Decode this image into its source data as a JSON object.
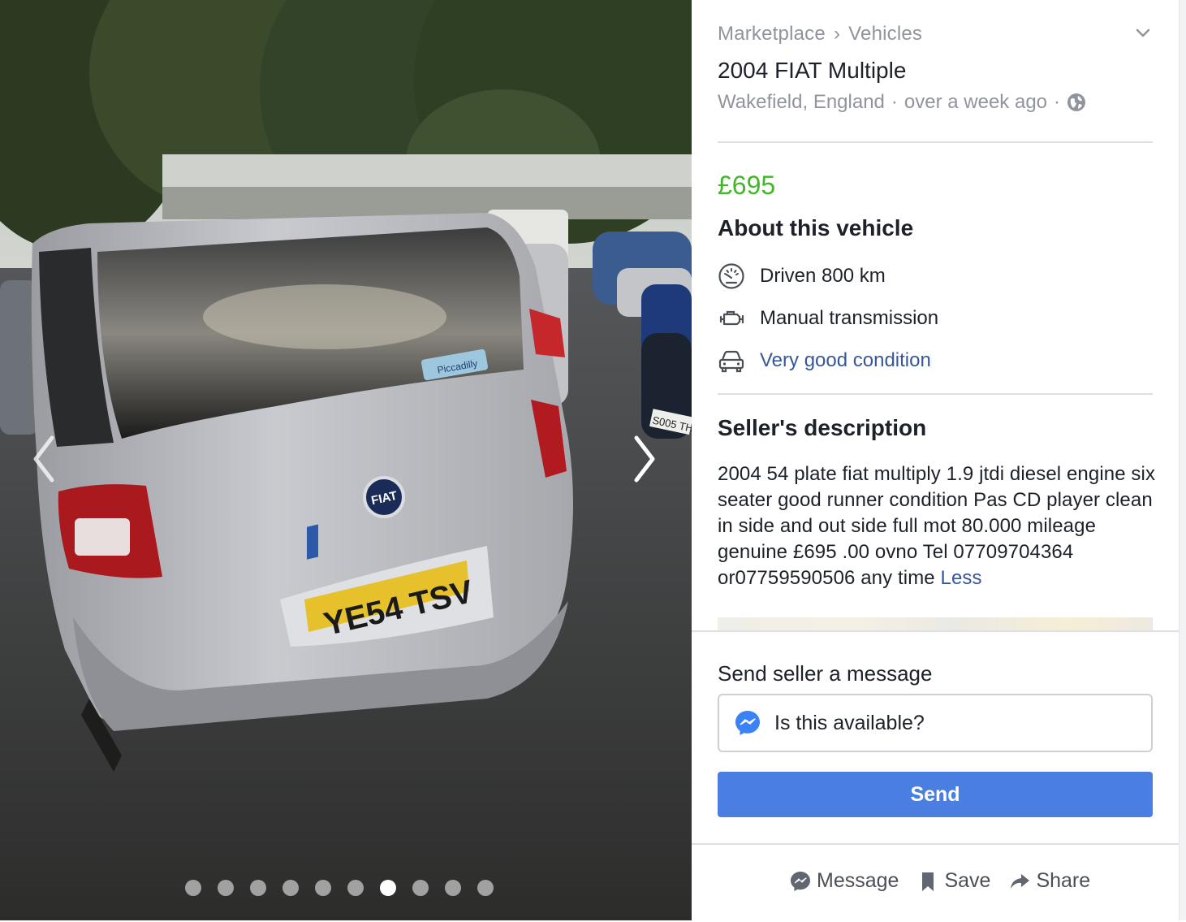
{
  "photo": {
    "plate_text": "YE54 TSV",
    "badge_text": "FIAT",
    "sticker_text": "Piccadilly",
    "bg_plate_text": "S005 TH",
    "slide_count": 10,
    "active_slide": 7
  },
  "panel": {
    "breadcrumb": {
      "root": "Marketplace",
      "separator": "›",
      "category": "Vehicles"
    },
    "title": "2004 FIAT Multiple",
    "location": "Wakefield, England",
    "time": "over a week ago",
    "price": "£695",
    "about_heading": "About this vehicle",
    "attributes": [
      {
        "icon": "speedometer-icon",
        "label": "Driven 800 km"
      },
      {
        "icon": "engine-icon",
        "label": "Manual transmission"
      },
      {
        "icon": "car-icon",
        "label": "Very good condition"
      }
    ],
    "seller_heading": "Seller's description",
    "description": "2004 54 plate fiat multiply 1.9 jtdi diesel engine six seater good runner condition Pas CD player clean in side and out side full mot 80.000 mileage genuine £695 .00 ovno Tel 07709704364 or07759590506 any time",
    "less_link": "Less"
  },
  "message": {
    "label": "Send seller a message",
    "input_value": "Is this available?",
    "send_label": "Send"
  },
  "actions": {
    "message_label": "Message",
    "save_label": "Save",
    "share_label": "Share"
  },
  "colors": {
    "price": "#42b72a",
    "link": "#365899",
    "send_button": "#4a7ee0",
    "muted": "#90949c"
  }
}
